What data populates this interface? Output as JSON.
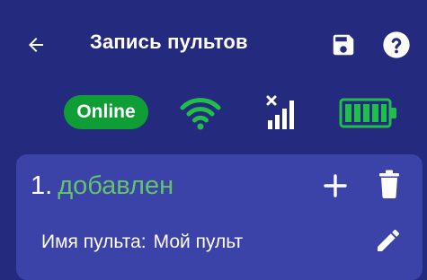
{
  "appbar": {
    "title": "Запись пультов",
    "back_icon": "arrow-left-icon",
    "save_icon": "floppy-disk-icon",
    "help_icon": "help-circle-icon"
  },
  "status": {
    "connection_label": "Online",
    "connection_color": "#0f9d36",
    "wifi_icon": "wifi-icon",
    "wifi_color": "#1fbf4a",
    "signal_icon": "cellular-signal-no-connection-icon",
    "battery_icon": "battery-full-icon",
    "battery_color": "#1fbf4a"
  },
  "remote": {
    "index": "1.",
    "state": "добавлен",
    "state_color": "#64c36a",
    "name_label": "Имя пульта:",
    "name_value": "Мой пульт",
    "add_icon": "plus-icon",
    "delete_icon": "trash-icon",
    "edit_icon": "pencil-icon"
  },
  "colors": {
    "background": "#242a7d",
    "card": "#3b42a8"
  }
}
